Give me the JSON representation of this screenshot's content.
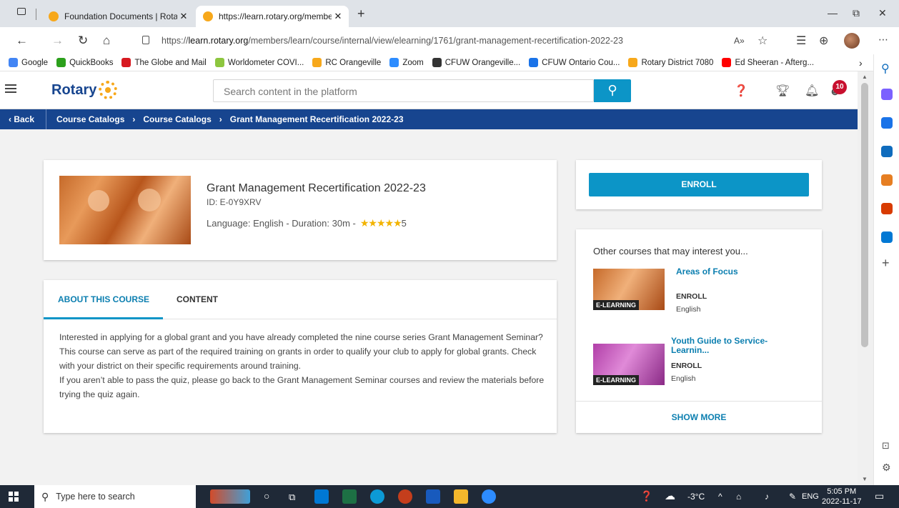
{
  "browser": {
    "tabs": [
      {
        "label": "Foundation Documents | Rotary I",
        "close": "✕"
      },
      {
        "label": "https://learn.rotary.org/member",
        "close": "✕"
      }
    ],
    "new_tab": "+",
    "window_controls": {
      "minimize": "—",
      "restore": "⧉",
      "close": "✕"
    },
    "url_prefix": "https://",
    "url_host": "learn.rotary.org",
    "url_path": "/members/learn/course/internal/view/elearning/1761/grant-management-recertification-2022-23",
    "bookmarks": [
      {
        "label": "Google",
        "color": "#4285f4"
      },
      {
        "label": "QuickBooks",
        "color": "#2ca01c"
      },
      {
        "label": "The Globe and Mail",
        "color": "#d71920"
      },
      {
        "label": "Worldometer COVI...",
        "color": "#8dc63f"
      },
      {
        "label": "RC Orangeville",
        "color": "#f7a81b"
      },
      {
        "label": "Zoom",
        "color": "#2d8cff"
      },
      {
        "label": "CFUW Orangeville...",
        "color": "#333333"
      },
      {
        "label": "CFUW Ontario Cou...",
        "color": "#1a73e8"
      },
      {
        "label": "Rotary District 7080",
        "color": "#f7a81b"
      },
      {
        "label": "Ed Sheeran - Afterg...",
        "color": "#ff0000"
      }
    ],
    "bookmarks_more": "›"
  },
  "header": {
    "logo_text": "Rotary",
    "search_placeholder": "Search content in the platform",
    "notification_count": "10"
  },
  "breadcrumb": {
    "back": "‹  Back",
    "items": [
      "Course Catalogs",
      "Course Catalogs",
      "Grant Management Recertification 2022-23"
    ],
    "separator": "›"
  },
  "course": {
    "title": "Grant Management Recertification 2022-23",
    "id": "ID: E-0Y9XRV",
    "meta": "Language: English  -  Duration: 30m  -",
    "stars": "★★★★★",
    "rating": "5"
  },
  "enroll": {
    "label": "ENROLL"
  },
  "course_tabs": {
    "about": "ABOUT THIS COURSE",
    "content": "CONTENT",
    "description": [
      "Interested in applying for a global grant and you have already completed the nine course series Grant Management Seminar? This course can serve as part of the required training on grants in order to qualify your club to apply for global grants. Check with your district on their specific requirements around training.",
      "If you aren’t able to pass the quiz, please go back to the Grant Management Seminar courses and review the materials before trying the quiz again."
    ]
  },
  "other_courses": {
    "title": "Other courses that may interest you...",
    "items": [
      {
        "name": "Areas of Focus",
        "badge": "E-LEARNING",
        "action": "ENROLL",
        "language": "English"
      },
      {
        "name": "Youth Guide to Service-Learnin...",
        "badge": "E-LEARNING",
        "action": "ENROLL",
        "language": "English"
      }
    ],
    "show_more": "SHOW MORE"
  },
  "taskbar": {
    "search_placeholder": "Type here to search",
    "weather": "-3°C",
    "language": "ENG",
    "time": "5:05 PM",
    "date": "2022-11-17"
  },
  "colors": {
    "rotary_blue": "#17458f",
    "accent": "#0c95c7",
    "rotary_gold": "#f7a81b",
    "badge_red": "#c8102e"
  }
}
